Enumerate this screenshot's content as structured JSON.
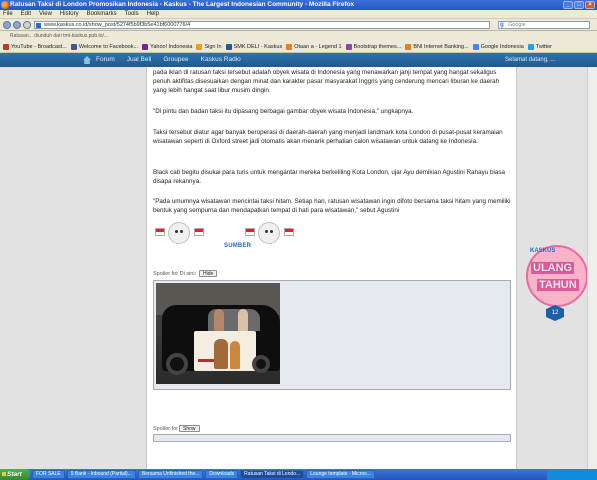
{
  "window": {
    "title": "Ratusan Taksi di London Promosikan Indonesia - Kaskus - The Largest Indonesian Community - Mozilla Firefox"
  },
  "menu": [
    "File",
    "Edit",
    "View",
    "History",
    "Bookmarks",
    "Tools",
    "Help"
  ],
  "tab_strip": "Ratusan... diunduh dari tmt-kaskus.pub.to/...",
  "address_bar": "www.kaskus.co.id/show_post/5274f5b9f3b5e41bf6000776/4",
  "search_placeholder": "Google",
  "bookmarks": [
    "YouTube - Broadcast...",
    "Welcome to Facebook...",
    "Yahoo! Indonesia",
    "Sign In",
    "SMK DELI - Kaskus",
    "Otaan a - Legend 1",
    "Bootstrap themes...",
    "BNI Internet Banking...",
    "Google Indonesia",
    "Twitter"
  ],
  "site_nav": {
    "items": [
      "Forum",
      "Jual Beli",
      "Groupee",
      "Kaskus Radio"
    ],
    "welcome": "Selamat datang, ..."
  },
  "article": {
    "p1": "pada iklan di ratusan taksi tersebut adalah obyek wisata di Indonesia yang menawarkan janji tempat yang hangat sekaligus penuh aktifitas disesuaikan dengan minat dan karakter pasar masyarakat Inggris yang cenderung mencari liburan ke daerah yang lebih hangat saat libur musim dingin.",
    "p2": "\"Di pintu dan badan taksi itu dipasang berbagai gambar obyek wisata Indonesia,\" ungkapnya.",
    "p3": "Taksi tersebut diatur agar banyak beroperasi di daerah-daerah yang menjadi landmark kota London di pusat-pusat keramaian wisatawan seperti di Oxford street jadi otomatis akan menarik perhatian calon wisatawan untuk datang ke Indonesia.",
    "p4": "Black cab begitu disukai para turis untuk mengantar mereka berkeliling Kota London, ujar Ayu demikian Agustini Rahayu biasa disapa rekannya.",
    "p5": "\"Pada umumnya wisatawan mencintai taksi hitam. Setiap hari, ratusan wisatawan ingin difoto bersama taksi hitam yang memiliki bentuk yang sempurna dan mendapatkan tempat di hati para wisatawan,\" sebut Agustini"
  },
  "sumber_label": "SUMBER",
  "spoiler1": {
    "label": "Spoiler for Di sini:",
    "button": "Hide"
  },
  "spoiler2": {
    "label": "Spoiler for",
    "button": "Show"
  },
  "widget": {
    "brand": "KASKUS",
    "line1": "ULANG",
    "line2": "TAHUN",
    "number": "12",
    "accent": "#e05aa0"
  },
  "taskbar": {
    "start": "Start",
    "tasks": [
      "FOR SALE",
      "9 Bank - Inbound (Partial)...",
      "Bersama Unfinished the...",
      "Downloads",
      "Ratusan Taksi di Londo...",
      "Lounge template - Micros..."
    ],
    "clock": ""
  },
  "colors": {
    "site_header": "#2f72ad",
    "sumber": "#1d6fc2",
    "taskbar": "#2654c0"
  }
}
